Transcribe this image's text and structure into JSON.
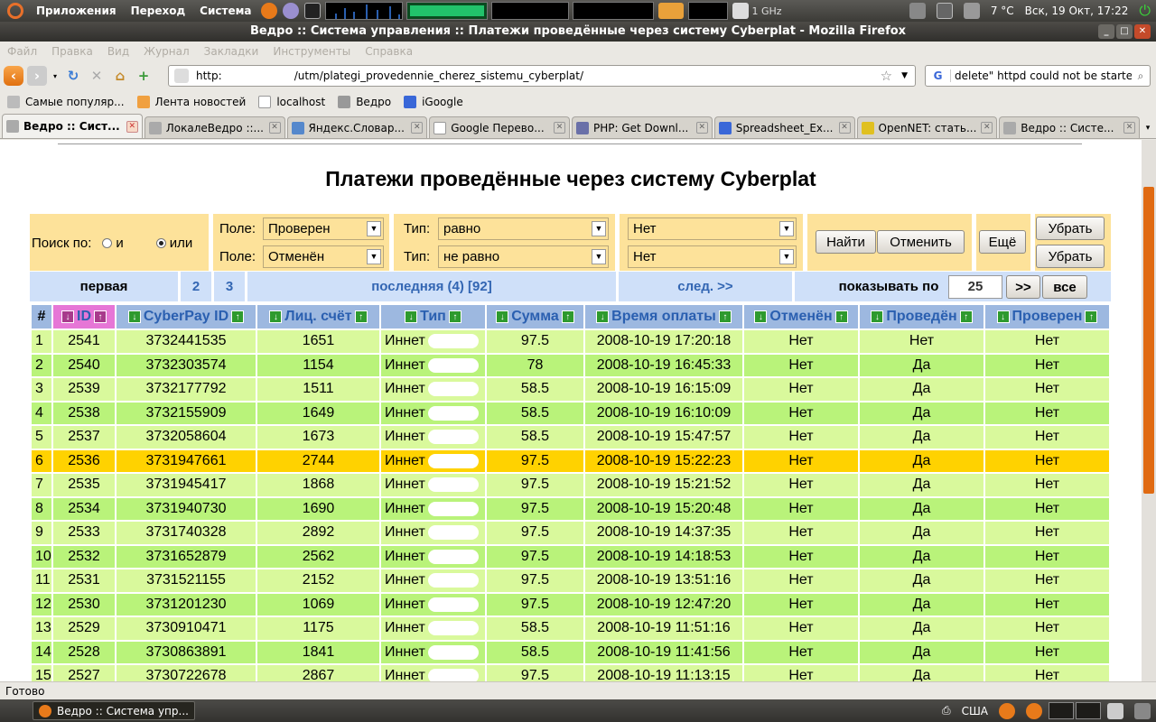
{
  "panel": {
    "menus": [
      "Приложения",
      "Переход",
      "Система"
    ],
    "cpu_freq": "1 GHz",
    "weather": "7 °C",
    "clock": "Вск, 19 Окт, 17:22"
  },
  "window": {
    "title": "Ведро :: Система управления :: Платежи проведённые через систему Cyberplat - Mozilla Firefox"
  },
  "menubar": [
    "Файл",
    "Правка",
    "Вид",
    "Журнал",
    "Закладки",
    "Инструменты",
    "Справка"
  ],
  "navbar": {
    "url_prefix": "http:",
    "url_path": "/utm/plategi_provedennie_cherez_sistemu_cyberplat/",
    "search_query": "delete\" httpd could not be started"
  },
  "bookmarks": [
    "Самые популяр...",
    "Лента новостей",
    "localhost",
    "Ведро",
    "iGoogle"
  ],
  "tabs": [
    {
      "label": "Ведро :: Сист...",
      "active": true
    },
    {
      "label": "ЛокалеВедро ::..."
    },
    {
      "label": "Яндекс.Словар..."
    },
    {
      "label": "Google Перево..."
    },
    {
      "label": "PHP: Get Downl..."
    },
    {
      "label": "Spreadsheet_Ex..."
    },
    {
      "label": "OpenNET: стать..."
    },
    {
      "label": "Ведро :: Систе..."
    }
  ],
  "page": {
    "title": "Платежи проведённые через систему Cyberplat"
  },
  "filter": {
    "search_label": "Поиск по:",
    "radio_and": "и",
    "radio_or": "или",
    "radio_selected": "или",
    "field_label": "Поле:",
    "type_label": "Тип:",
    "rows": [
      {
        "field": "Проверен",
        "type": "равно",
        "value": "Нет"
      },
      {
        "field": "Отменён",
        "type": "не равно",
        "value": "Нет"
      }
    ],
    "find_button": "Найти",
    "cancel_button": "Отменить",
    "more_button": "Ещё",
    "remove_button": "Убрать"
  },
  "pager": {
    "first": "первая",
    "pages": [
      "2",
      "3"
    ],
    "last": "последняя (4) [92]",
    "next": "след. >>",
    "per_page_label": "показывать по",
    "per_page_value": "25",
    "go_button": ">>",
    "all_button": "все"
  },
  "table": {
    "columns": [
      "#",
      "ID",
      "CyberPay ID",
      "Лиц. счёт",
      "Тип",
      "Сумма",
      "Время оплаты",
      "Отменён",
      "Проведён",
      "Проверен"
    ],
    "type_prefix": "Иннет",
    "rows": [
      [
        "1",
        "2541",
        "3732441535",
        "1651",
        "Иннет",
        "97.5",
        "2008-10-19 17:20:18",
        "Нет",
        "Нет",
        "Нет"
      ],
      [
        "2",
        "2540",
        "3732303574",
        "1154",
        "Иннет",
        "78",
        "2008-10-19 16:45:33",
        "Нет",
        "Да",
        "Нет"
      ],
      [
        "3",
        "2539",
        "3732177792",
        "1511",
        "Иннет",
        "58.5",
        "2008-10-19 16:15:09",
        "Нет",
        "Да",
        "Нет"
      ],
      [
        "4",
        "2538",
        "3732155909",
        "1649",
        "Иннет",
        "58.5",
        "2008-10-19 16:10:09",
        "Нет",
        "Да",
        "Нет"
      ],
      [
        "5",
        "2537",
        "3732058604",
        "1673",
        "Иннет",
        "58.5",
        "2008-10-19 15:47:57",
        "Нет",
        "Да",
        "Нет"
      ],
      [
        "6",
        "2536",
        "3731947661",
        "2744",
        "Иннет",
        "97.5",
        "2008-10-19 15:22:23",
        "Нет",
        "Да",
        "Нет"
      ],
      [
        "7",
        "2535",
        "3731945417",
        "1868",
        "Иннет",
        "97.5",
        "2008-10-19 15:21:52",
        "Нет",
        "Да",
        "Нет"
      ],
      [
        "8",
        "2534",
        "3731940730",
        "1690",
        "Иннет",
        "97.5",
        "2008-10-19 15:20:48",
        "Нет",
        "Да",
        "Нет"
      ],
      [
        "9",
        "2533",
        "3731740328",
        "2892",
        "Иннет",
        "97.5",
        "2008-10-19 14:37:35",
        "Нет",
        "Да",
        "Нет"
      ],
      [
        "10",
        "2532",
        "3731652879",
        "2562",
        "Иннет",
        "97.5",
        "2008-10-19 14:18:53",
        "Нет",
        "Да",
        "Нет"
      ],
      [
        "11",
        "2531",
        "3731521155",
        "2152",
        "Иннет",
        "97.5",
        "2008-10-19 13:51:16",
        "Нет",
        "Да",
        "Нет"
      ],
      [
        "12",
        "2530",
        "3731201230",
        "1069",
        "Иннет",
        "97.5",
        "2008-10-19 12:47:20",
        "Нет",
        "Да",
        "Нет"
      ],
      [
        "13",
        "2529",
        "3730910471",
        "1175",
        "Иннет",
        "58.5",
        "2008-10-19 11:51:16",
        "Нет",
        "Да",
        "Нет"
      ],
      [
        "14",
        "2528",
        "3730863891",
        "1841",
        "Иннет",
        "58.5",
        "2008-10-19 11:41:56",
        "Нет",
        "Да",
        "Нет"
      ],
      [
        "15",
        "2527",
        "3730722678",
        "2867",
        "Иннет",
        "97.5",
        "2008-10-19 11:13:15",
        "Нет",
        "Да",
        "Нет"
      ]
    ],
    "highlighted_row": 5
  },
  "status": {
    "text": "Готово"
  },
  "taskbar": {
    "item": "Ведро :: Система упр...",
    "keyboard_layout": "США"
  },
  "colors": {
    "filter_bg": "#fde29a",
    "pager_bg": "#cfe0f9",
    "header_bg": "#9db8e0",
    "row_light": "#d9f99c",
    "row_dark": "#b9f37a",
    "row_highlight": "#ffd200",
    "sorted_header": "#e676d6"
  }
}
